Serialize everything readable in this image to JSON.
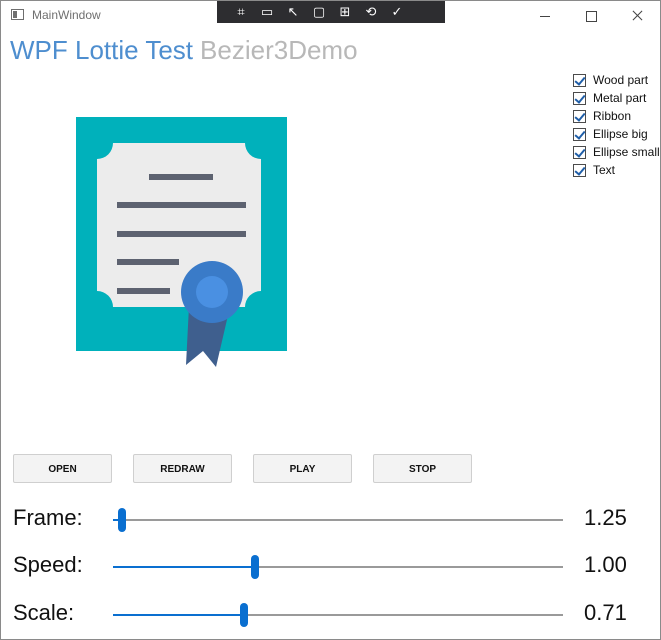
{
  "window": {
    "title": "MainWindow"
  },
  "debug_toolbar": {
    "icons": [
      "select-element-icon",
      "record-icon",
      "pointer-icon",
      "square-icon",
      "layout-icon",
      "refresh-icon",
      "check-circle-icon"
    ]
  },
  "header": {
    "title": "WPF Lottie Test",
    "subtitle": "Bezier3Demo"
  },
  "layers": [
    {
      "label": "Wood part",
      "checked": true
    },
    {
      "label": "Metal part",
      "checked": true
    },
    {
      "label": "Ribbon",
      "checked": true
    },
    {
      "label": "Ellipse big",
      "checked": true
    },
    {
      "label": "Ellipse small",
      "checked": true
    },
    {
      "label": "Text",
      "checked": true
    }
  ],
  "buttons": {
    "open": "OPEN",
    "redraw": "REDRAW",
    "play": "PLAY",
    "stop": "STOP"
  },
  "sliders": {
    "frame": {
      "label": "Frame:",
      "display": "1.25",
      "fraction": 0.02
    },
    "speed": {
      "label": "Speed:",
      "display": "1.00",
      "fraction": 0.315
    },
    "scale": {
      "label": "Scale:",
      "display": "0.71",
      "fraction": 0.29
    }
  },
  "colors": {
    "accent": "#0a6fd0",
    "header_title": "#4e8ecf",
    "header_subtitle": "#b8b8b8",
    "frame_teal": "#00b1bb",
    "paper": "#ececec",
    "text_lines": "#5d6270",
    "medal_outer": "#3a7bc8",
    "medal_inner": "#4a90e2",
    "ribbon": "#3f5f8e"
  }
}
